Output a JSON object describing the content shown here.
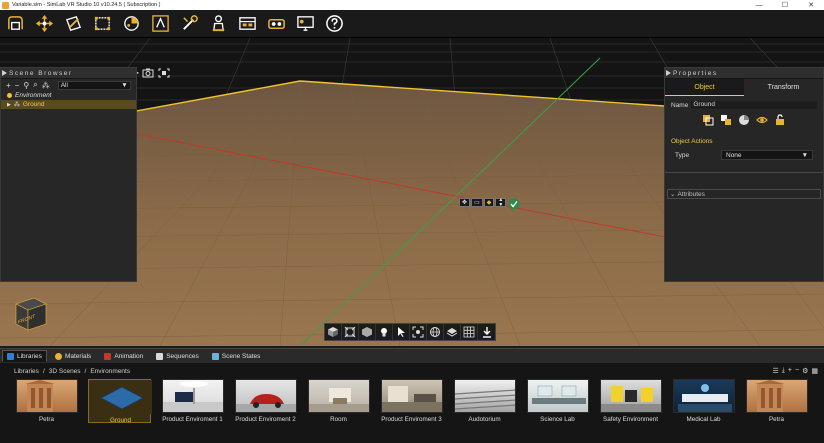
{
  "window": {
    "title": "Variable.sim - SimLab VR Studio 10 v10.24.5 ( Subscription )",
    "minimize": "—",
    "maximize": "☐",
    "close": "✕"
  },
  "toolbar": {
    "icons": [
      "open-scene-icon",
      "move-icon",
      "edit-icon",
      "select-box-icon",
      "materials-icon",
      "paint-icon",
      "tools-icon",
      "presenter-icon",
      "variation-icon",
      "vr-headset-icon",
      "screen-share-icon",
      "help-icon"
    ]
  },
  "scene_browser": {
    "title": "Scene Browser",
    "filter_value": "All",
    "items": [
      {
        "label": "Environment"
      },
      {
        "label": "Ground"
      }
    ]
  },
  "properties": {
    "title": "Properties",
    "tabs": [
      "Object",
      "Transform"
    ],
    "name_label": "Name",
    "name_value": "Ground",
    "object_actions_title": "Object Actions",
    "type_label": "Type",
    "type_value": "None",
    "attributes_label": "Attributes"
  },
  "viewcube": {
    "label": "FRONT"
  },
  "library_tabs": [
    {
      "label": "Libraries",
      "color": "#2f7fd6"
    },
    {
      "label": "Materials",
      "color": "#e8b234"
    },
    {
      "label": "Animation",
      "color": "#c0392b"
    },
    {
      "label": "Sequences",
      "color": "#d8d8d8"
    },
    {
      "label": "Scene States",
      "color": "#6bb0d8"
    }
  ],
  "library_path": [
    "Libraries",
    "3D Scenes",
    "Environments"
  ],
  "library_items": [
    {
      "label": "Petra"
    },
    {
      "label": "Ground"
    },
    {
      "label": "Product Enviroment 1"
    },
    {
      "label": "Product Enviroment 2"
    },
    {
      "label": "Room"
    },
    {
      "label": "Product Enviroment 3"
    },
    {
      "label": "Audotorium"
    },
    {
      "label": "Science Lab"
    },
    {
      "label": "Safety Environment"
    },
    {
      "label": "Medical Lab"
    },
    {
      "label": "Petra"
    }
  ],
  "colors": {
    "accent": "#f0c84a",
    "floor": "#8a6a48",
    "axis_red": "#c0392b",
    "axis_green": "#3aa046"
  }
}
